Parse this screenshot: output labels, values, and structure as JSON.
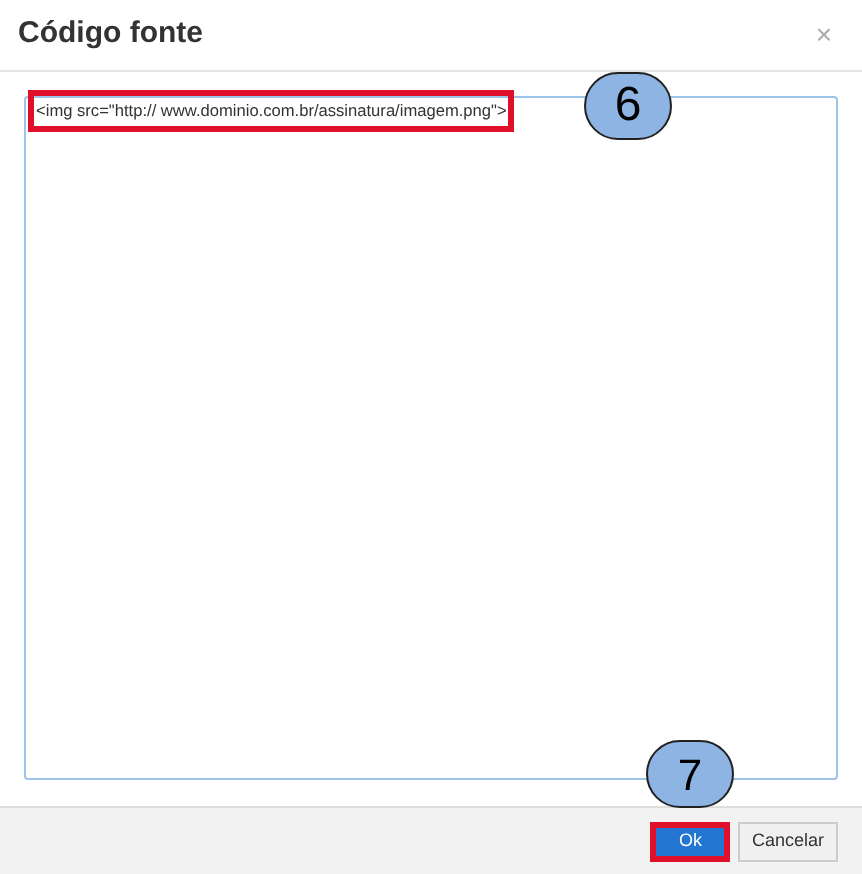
{
  "dialog": {
    "title": "Código fonte",
    "close": "×"
  },
  "editor": {
    "value": "<img src=\"http:// www.dominio.com.br/assinatura/imagem.png\">"
  },
  "callouts": [
    {
      "label": "6"
    },
    {
      "label": "7"
    }
  ],
  "buttons": [
    {
      "label": "Ok",
      "kind": "primary"
    },
    {
      "label": "Cancelar",
      "kind": "secondary"
    }
  ]
}
